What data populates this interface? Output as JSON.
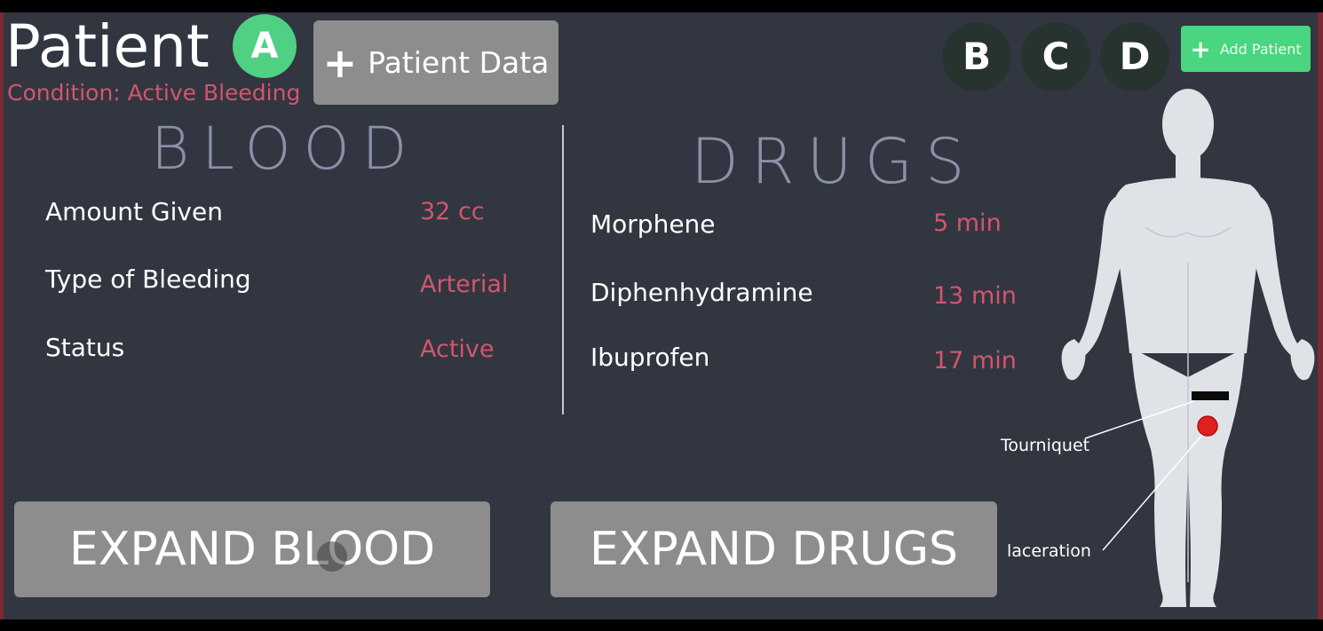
{
  "header": {
    "title": "Patient",
    "active_patient": "A",
    "condition": "Condition: Active Bleeding",
    "patient_data_label": "Patient Data",
    "other_patients": [
      "B",
      "C",
      "D"
    ],
    "add_patient_label": "Add Patient"
  },
  "blood": {
    "heading": "BLOOD",
    "rows": [
      {
        "label": "Amount Given",
        "value": "32 cc"
      },
      {
        "label": "Type of Bleeding",
        "value": "Arterial"
      },
      {
        "label": "Status",
        "value": "Active"
      }
    ],
    "expand_label": "EXPAND BLOOD"
  },
  "drugs": {
    "heading": "DRUGS",
    "rows": [
      {
        "label": "Morphene",
        "value": "5 min"
      },
      {
        "label": "Diphenhydramine",
        "value": "13 min"
      },
      {
        "label": "Ibuprofen",
        "value": "17 min"
      }
    ],
    "expand_label": "EXPAND DRUGS"
  },
  "body_map": {
    "annotations": {
      "tourniquet": "Tourniquet",
      "laceration": "laceration"
    }
  },
  "colors": {
    "background": "#323640",
    "accent_green": "#4fd083",
    "value_red": "#d2566c",
    "wound_red": "#e02020",
    "heading_gray": "#8c90a8"
  }
}
